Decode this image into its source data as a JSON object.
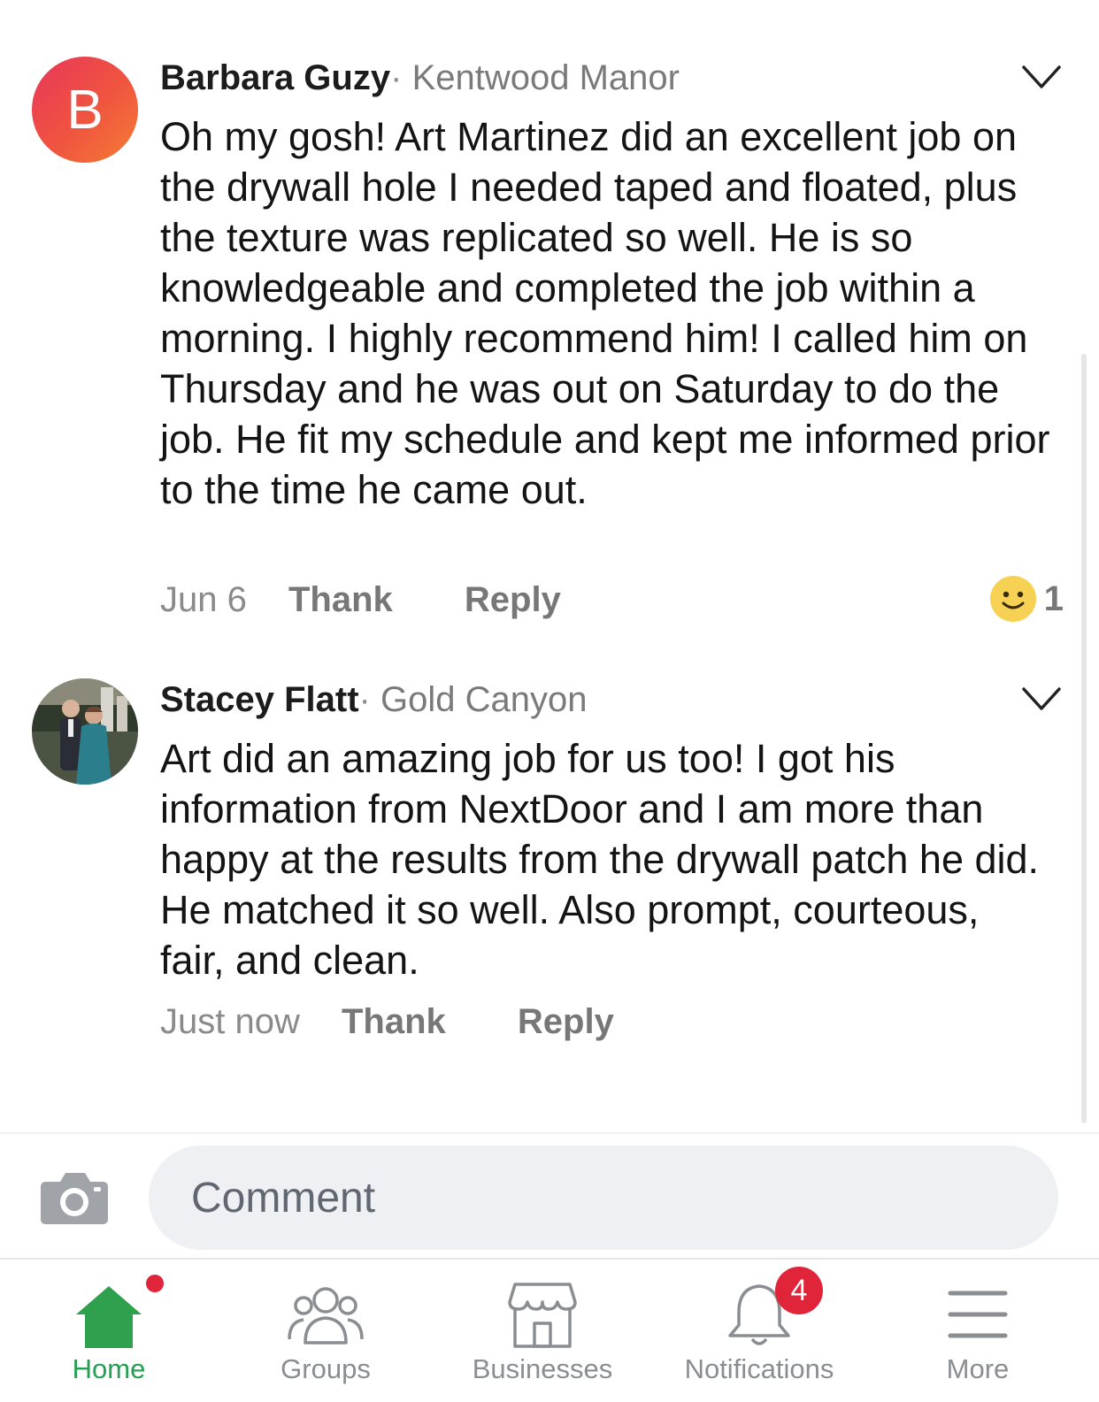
{
  "comments": [
    {
      "avatar_letter": "B",
      "author": "Barbara Guzy",
      "separator": "·",
      "location": "Kentwood Manor",
      "body": "Oh my gosh!  Art Martinez did an excellent job on the drywall hole I needed taped and floated, plus the texture was replicated so well.  He is so knowledgeable and completed the job within a morning.  I highly recommend him!  I called him on Thursday and he was out on Saturday to do the job.  He fit my schedule and kept me informed prior to the time he came out.",
      "timestamp": "Jun 6",
      "thank_label": "Thank",
      "reply_label": "Reply",
      "reaction_count": "1"
    },
    {
      "author": "Stacey Flatt",
      "separator": "·",
      "location": "Gold Canyon",
      "body": "Art did an amazing job for us too! I got his information from NextDoor and I am more than happy at the results from the drywall patch he did. He matched it so well. Also prompt, courteous, fair, and clean.",
      "timestamp": "Just now",
      "thank_label": "Thank",
      "reply_label": "Reply"
    }
  ],
  "composer": {
    "placeholder": "Comment"
  },
  "tabbar": {
    "home": "Home",
    "groups": "Groups",
    "businesses": "Businesses",
    "notifications": "Notifications",
    "notifications_badge": "4",
    "more": "More"
  },
  "colors": {
    "accent_green": "#25a052",
    "badge_red": "#e0243a",
    "reaction_yellow": "#f7d154"
  }
}
